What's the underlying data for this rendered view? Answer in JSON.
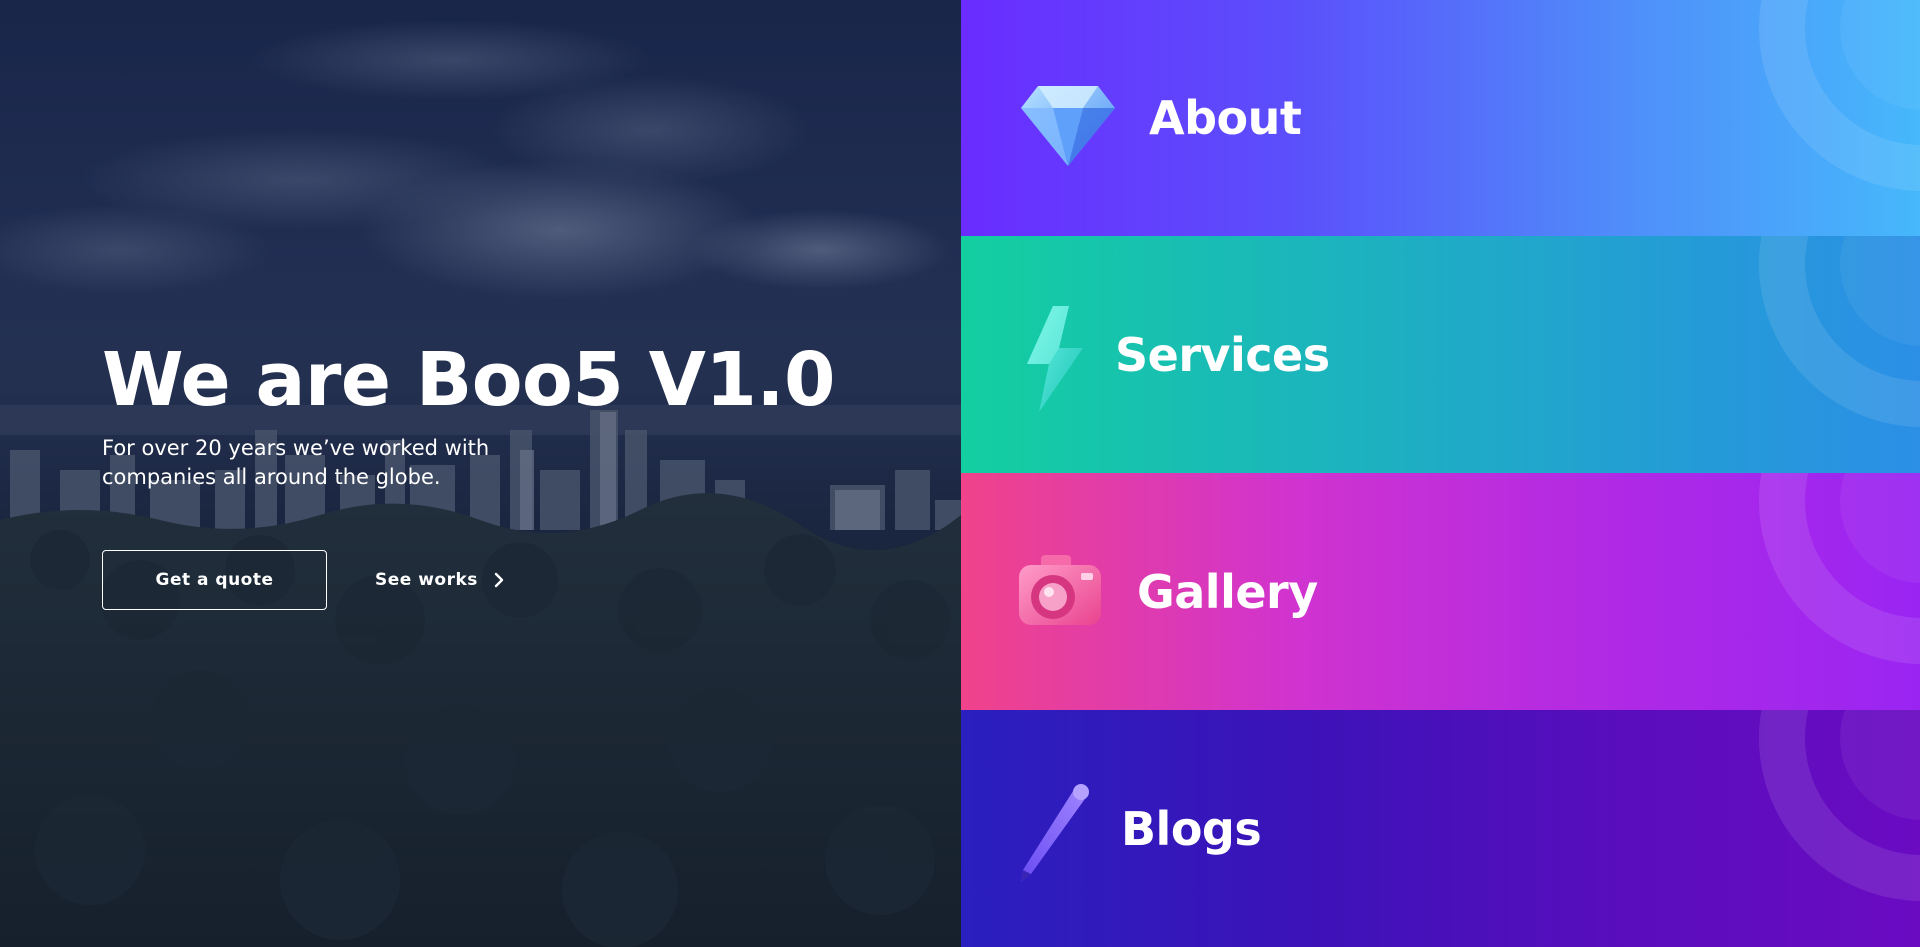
{
  "hero": {
    "title": "We are Boo5 V1.0",
    "subtitle": "For over 20 years we’ve worked with\ncompanies all around the globe.",
    "primary_button": "Get a quote",
    "secondary_button": "See works",
    "background": "city-skyline-forest-photo"
  },
  "menu": {
    "items": [
      {
        "label": "About",
        "icon": "diamond-icon",
        "gradient": [
          "#6a2cff",
          "#46b8fb"
        ]
      },
      {
        "label": "Services",
        "icon": "lightning-icon",
        "gradient": [
          "#13cfa0",
          "#2b8fe6"
        ]
      },
      {
        "label": "Gallery",
        "icon": "camera-icon",
        "gradient": [
          "#f0438a",
          "#9a25f2"
        ]
      },
      {
        "label": "Blogs",
        "icon": "pen-icon",
        "gradient": [
          "#2a1fbf",
          "#6a0bc2"
        ]
      }
    ]
  }
}
